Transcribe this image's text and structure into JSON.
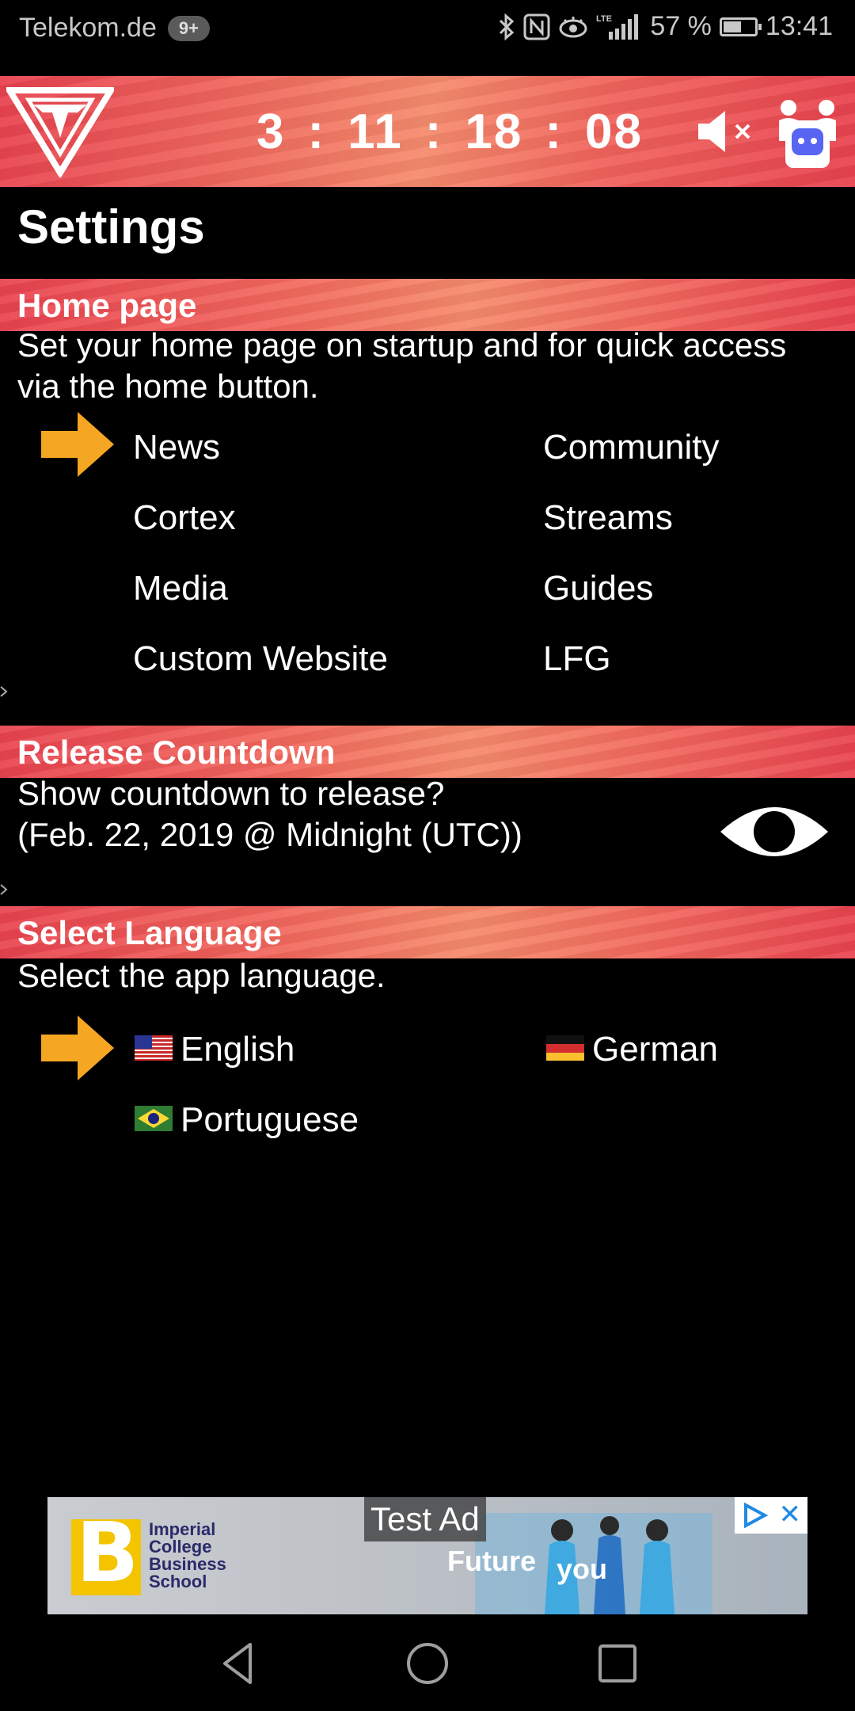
{
  "status_bar": {
    "carrier": "Telekom.de",
    "badge": "9+",
    "network": "LTE",
    "battery_text": "57 %",
    "battery_level": 0.57,
    "time": "13:41",
    "icons": [
      "bluetooth-icon",
      "nfc-icon",
      "eye-comfort-icon",
      "signal-icon",
      "battery-icon"
    ]
  },
  "header": {
    "countdown": {
      "days": "3",
      "hours": "11",
      "minutes": "18",
      "seconds": "08",
      "separator": ":"
    },
    "icons": [
      "app-logo",
      "sound-muted-icon",
      "discord-icon"
    ]
  },
  "page": {
    "title": "Settings"
  },
  "sections": {
    "home_page": {
      "heading": "Home page",
      "description": "Set your home page on startup and for quick access via the home button.",
      "selected": "News",
      "options": [
        "News",
        "Community",
        "Cortex",
        "Streams",
        "Media",
        "Guides",
        "Custom Website",
        "LFG"
      ]
    },
    "release_countdown": {
      "heading": "Release Countdown",
      "line1": "Show countdown to release?",
      "line2": "(Feb. 22, 2019 @ Midnight (UTC))",
      "visible": true
    },
    "language": {
      "heading": "Select Language",
      "description": "Select the app language.",
      "selected": "English",
      "options": [
        "English",
        "German",
        "Portuguese"
      ]
    }
  },
  "ad": {
    "label": "Test Ad",
    "brand_lines": [
      "Imperial",
      "College",
      "Business",
      "School"
    ],
    "tagline_a": "Future",
    "tagline_b": "you",
    "close": "✕"
  },
  "colors": {
    "accent_orange": "#F5A623",
    "band_red": "#E9434F",
    "band_salmon": "#F58A6B"
  }
}
